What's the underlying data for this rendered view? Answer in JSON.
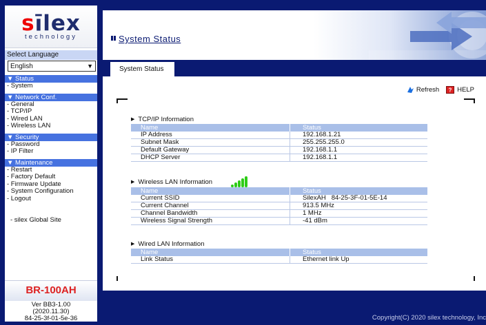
{
  "logo": {
    "word_red": "s",
    "word_rest": "lex",
    "word_i": "ī",
    "subtitle": "technology"
  },
  "language": {
    "label": "Select Language",
    "selected": "English"
  },
  "menu": [
    {
      "heading": "▼ Status",
      "items": [
        "- System"
      ]
    },
    {
      "heading": "▼ Network Conf.",
      "items": [
        "- General",
        "- TCP/IP",
        "- Wired LAN",
        "- Wireless LAN"
      ]
    },
    {
      "heading": "▼ Security",
      "items": [
        "- Password",
        "- IP Filter"
      ]
    },
    {
      "heading": "▼ Maintenance",
      "items": [
        "- Restart",
        "- Factory Default",
        "- Firmware Update",
        "- System Configuration",
        "- Logout"
      ]
    }
  ],
  "global_site": "-  silex Global Site",
  "model": "BR-100AH",
  "version": {
    "line1": "Ver BB3-1.00",
    "line2": "(2020.11.30)",
    "line3": "84-25-3f-01-5e-36"
  },
  "page_title": "System Status",
  "tab_label": "System Status",
  "tools": {
    "refresh": "Refresh",
    "help": "HELP"
  },
  "sections": {
    "tcp": {
      "title": "TCP/IP Information",
      "headers": [
        "Name",
        "Status"
      ],
      "rows": [
        [
          "IP Address",
          "192.168.1.21"
        ],
        [
          "Subnet Mask",
          "255.255.255.0"
        ],
        [
          "Default Gateway",
          "192.168.1.1"
        ],
        [
          "DHCP Server",
          "192.168.1.1"
        ]
      ]
    },
    "wireless": {
      "title": "Wireless LAN Information",
      "headers": [
        "Name",
        "Status"
      ],
      "rows": [
        [
          "Current SSID",
          "SilexAH   84-25-3F-01-5E-14"
        ],
        [
          "Current Channel",
          "913.5 MHz"
        ],
        [
          "Channel Bandwidth",
          "1 MHz"
        ],
        [
          "Wireless Signal Strength",
          "-41 dBm"
        ]
      ],
      "signal_bars": 5
    },
    "wired": {
      "title": "Wired LAN Information",
      "headers": [
        "Name",
        "Status"
      ],
      "rows": [
        [
          "Link Status",
          "Ethernet link Up"
        ]
      ]
    }
  },
  "copyright": "Copyright(C) 2020 silex technology, Inc",
  "colors": {
    "navy": "#0a1a72",
    "menu_blue": "#4672e0",
    "table_header": "#a9bfe8",
    "model_red": "#d22"
  }
}
